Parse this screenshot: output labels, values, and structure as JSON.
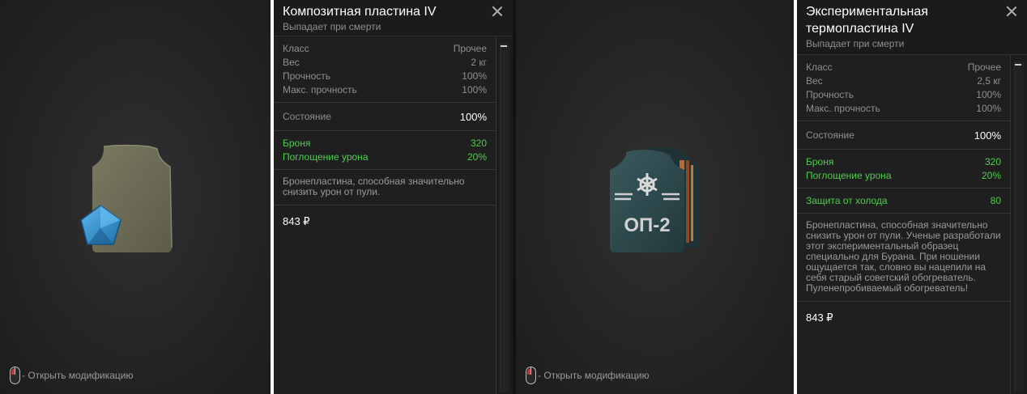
{
  "left": {
    "hint": "- Открыть модификацию",
    "title": "Композитная пластина IV",
    "subtitle": "Выпадает при смерти",
    "specs": [
      {
        "label": "Класс",
        "value": "Прочее"
      },
      {
        "label": "Вес",
        "value": "2 кг"
      },
      {
        "label": "Прочность",
        "value": "100%"
      },
      {
        "label": "Макс. прочность",
        "value": "100%"
      }
    ],
    "condition": {
      "label": "Состояние",
      "value": "100%"
    },
    "bonuses": [
      {
        "label": "Броня",
        "value": "320"
      },
      {
        "label": "Поглощение урона",
        "value": "20%"
      }
    ],
    "description": "Бронепластина, способная значительно снизить урон от пули.",
    "price": "843 ₽",
    "colors": {
      "plate": "#6b6a55",
      "gem": "#2f8fcf"
    }
  },
  "right": {
    "hint": "- Открыть модификацию",
    "title": "Экспериментальная термопластина IV",
    "subtitle": "Выпадает при смерти",
    "specs": [
      {
        "label": "Класс",
        "value": "Прочее"
      },
      {
        "label": "Вес",
        "value": "2,5 кг"
      },
      {
        "label": "Прочность",
        "value": "100%"
      },
      {
        "label": "Макс. прочность",
        "value": "100%"
      }
    ],
    "condition": {
      "label": "Состояние",
      "value": "100%"
    },
    "bonuses": [
      {
        "label": "Броня",
        "value": "320"
      },
      {
        "label": "Поглощение урона",
        "value": "20%"
      }
    ],
    "cold": {
      "label": "Защита от холода",
      "value": "80"
    },
    "description": "Бронепластина, способная значительно снизить урон от пули. Ученые разработали этот экспериментальный образец специально для Бурана. При ношении ощущается так, словно вы нацепили на себя старый советский обогреватель. Пуленепробиваемый обогреватель!",
    "price": "843 ₽",
    "plate_marking": "ОП-2",
    "colors": {
      "plate": "#2d4a4e",
      "accent": "#b8693a"
    }
  }
}
